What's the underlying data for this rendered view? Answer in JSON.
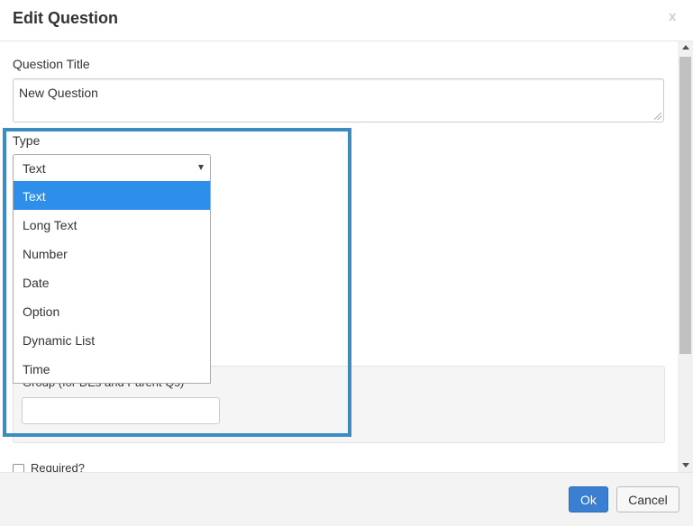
{
  "dialog": {
    "title": "Edit Question",
    "close_label": "x"
  },
  "form": {
    "question_title_label": "Question Title",
    "question_title_value": "New Question",
    "type_label": "Type",
    "type_selected": "Text",
    "type_options": [
      "Text",
      "Long Text",
      "Number",
      "Date",
      "Option",
      "Dynamic List",
      "Time"
    ],
    "group_label": "Group (for DEs and Parent Qs)",
    "group_value": "",
    "required_label": "Required?"
  },
  "footer": {
    "ok_label": "Ok",
    "cancel_label": "Cancel"
  },
  "colors": {
    "highlight_border": "#3a8cc1",
    "selected_option_bg": "#2e8fea",
    "ok_button_bg": "#3b7fd2"
  }
}
